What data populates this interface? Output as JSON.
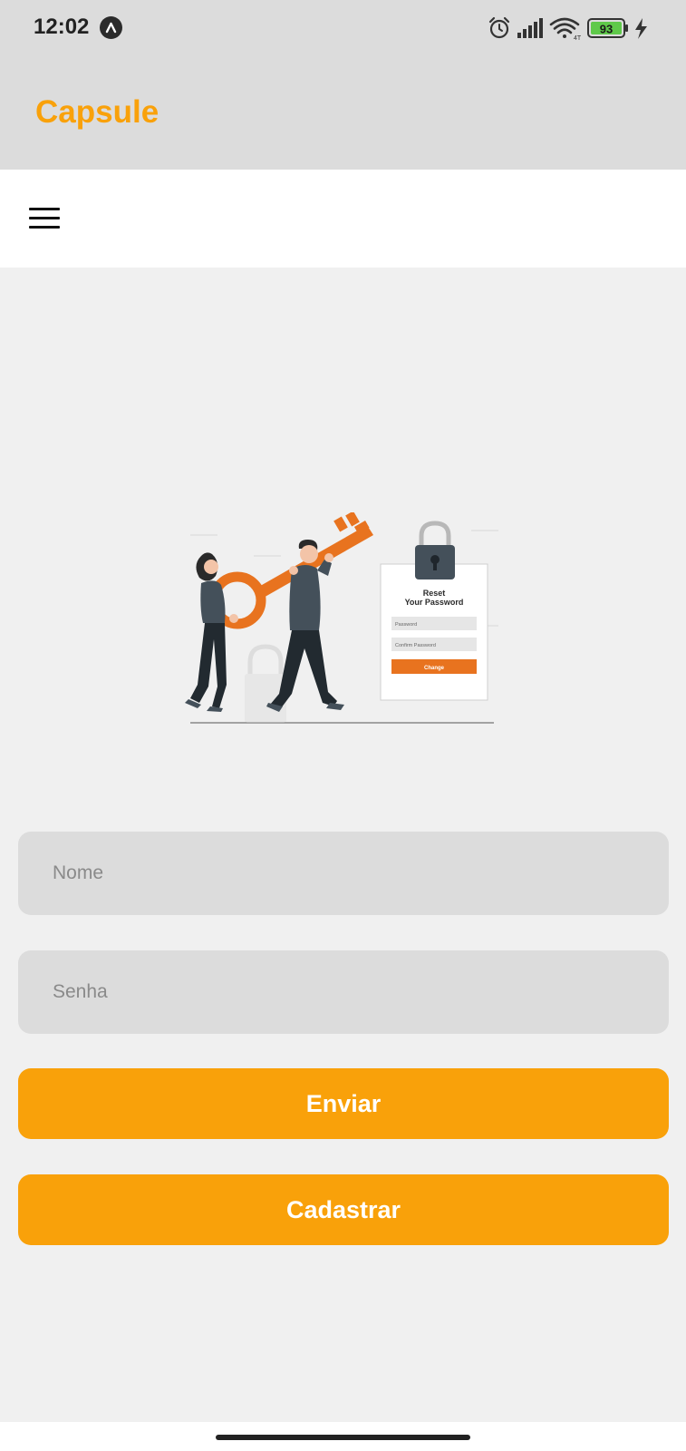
{
  "status_bar": {
    "time": "12:02",
    "battery": "93",
    "icons": [
      "alarm-icon",
      "signal-icon",
      "wifi-icon",
      "battery-icon",
      "charging-icon"
    ]
  },
  "header": {
    "title": "Capsule"
  },
  "toolbar": {
    "menu_icon": "hamburger-menu-icon"
  },
  "illustration": {
    "card_title_line1": "Reset",
    "card_title_line2": "Your Password",
    "field1": "Password",
    "field2": "Confirm Password",
    "button": "Change"
  },
  "form": {
    "name_placeholder": "Nome",
    "password_placeholder": "Senha",
    "submit_label": "Enviar",
    "register_label": "Cadastrar"
  },
  "colors": {
    "accent": "#f9a10a",
    "header_bg": "#dcdcdc",
    "page_bg": "#f0f0f0",
    "illustration_orange": "#e8731f"
  }
}
